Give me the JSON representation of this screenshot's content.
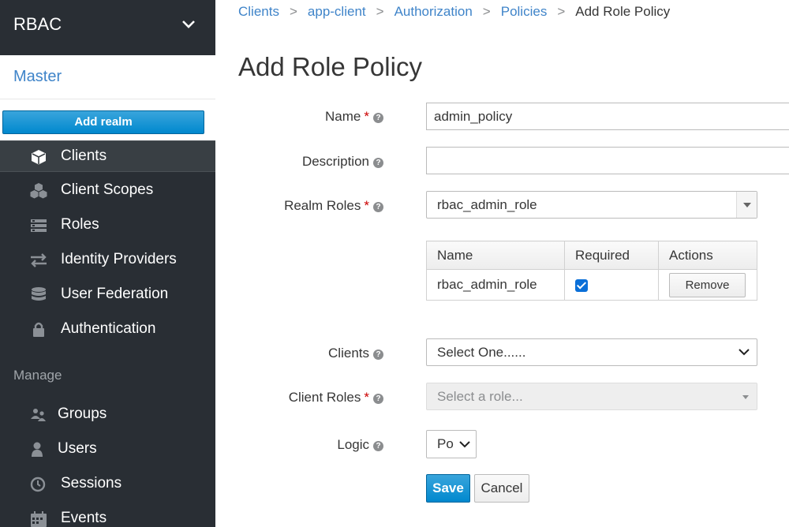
{
  "sidebar": {
    "realm_selector": {
      "name": "RBAC",
      "icon": "chevron-down-icon"
    },
    "current_realm": "Master",
    "add_realm_label": "Add realm",
    "configure_items": [
      {
        "label": "Clients",
        "icon": "cube-icon",
        "active": true
      },
      {
        "label": "Client Scopes",
        "icon": "cubes-icon",
        "active": false
      },
      {
        "label": "Roles",
        "icon": "list-icon",
        "active": false
      },
      {
        "label": "Identity Providers",
        "icon": "exchange-icon",
        "active": false
      },
      {
        "label": "User Federation",
        "icon": "database-icon",
        "active": false
      },
      {
        "label": "Authentication",
        "icon": "lock-icon",
        "active": false
      }
    ],
    "manage_heading": "Manage",
    "manage_items": [
      {
        "label": "Groups",
        "icon": "users-icon"
      },
      {
        "label": "Users",
        "icon": "user-icon"
      },
      {
        "label": "Sessions",
        "icon": "clock-icon"
      },
      {
        "label": "Events",
        "icon": "calendar-icon"
      }
    ]
  },
  "breadcrumb": [
    "Clients",
    "app-client",
    "Authorization",
    "Policies",
    "Add Role Policy"
  ],
  "page_title": "Add Role Policy",
  "form": {
    "name": {
      "label": "Name",
      "required": true,
      "value": "admin_policy"
    },
    "description": {
      "label": "Description",
      "required": false,
      "value": ""
    },
    "realm_roles": {
      "label": "Realm Roles",
      "required": true,
      "value": "rbac_admin_role"
    },
    "roles_table": {
      "headers": [
        "Name",
        "Required",
        "Actions"
      ],
      "rows": [
        {
          "name": "rbac_admin_role",
          "required": true,
          "action": "Remove"
        }
      ]
    },
    "clients": {
      "label": "Clients",
      "required": false,
      "value": "Select One......"
    },
    "client_roles": {
      "label": "Client Roles",
      "required": true,
      "placeholder": "Select a role..."
    },
    "logic": {
      "label": "Logic",
      "required": false,
      "value": "Po"
    },
    "save_label": "Save",
    "cancel_label": "Cancel",
    "required_mark": "*",
    "help_glyph": "?"
  },
  "colors": {
    "sidebar_bg": "#292e34",
    "link": "#3f84c9",
    "primary": "#0088ce",
    "required": "#cc0000"
  }
}
